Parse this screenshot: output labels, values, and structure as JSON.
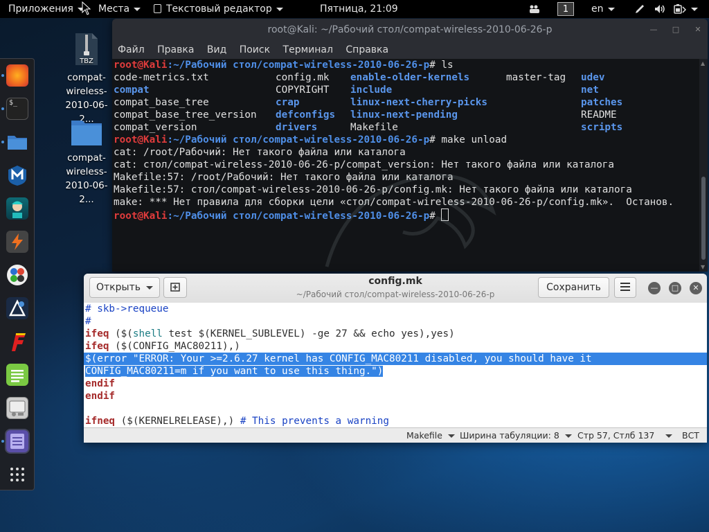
{
  "topbar": {
    "apps_label": "Приложения",
    "places_label": "Места",
    "active_app_label": "Текстовый редактор",
    "clock": "Пятница, 21:09",
    "workspace": "1",
    "keyboard_layout": "en"
  },
  "desktop_icons": [
    {
      "badge": "TBZ",
      "label": "compat-wireless-2010-06-2..."
    },
    {
      "label": "compat-wireless-2010-06-2..."
    }
  ],
  "dock": {
    "items": [
      "firefox-icon",
      "terminal-icon",
      "files-icon",
      "metasploit-icon",
      "armitage-icon",
      "burpsuite-icon",
      "maltego-icon",
      "beef-icon",
      "faraday-icon",
      "leafpad-icon",
      "cherrytree-icon",
      "text-editor-icon",
      "show-apps-icon"
    ]
  },
  "terminal": {
    "title": "root@Kali: ~/Рабочий стол/compat-wireless-2010-06-26-p",
    "menu": [
      "Файл",
      "Правка",
      "Вид",
      "Поиск",
      "Терминал",
      "Справка"
    ],
    "prompt_user": "root@Kali",
    "prompt_path": ":~/Рабочий стол/compat-wireless-2010-06-26-p",
    "prompt_suffix": "# ",
    "cmd1": "ls",
    "ls_rows": [
      [
        {
          "t": "code-metrics.txt",
          "d": false
        },
        {
          "t": "config.mk",
          "d": false
        },
        {
          "t": "enable-older-kernels",
          "d": true
        },
        {
          "t": "master-tag",
          "d": false
        },
        {
          "t": "udev",
          "d": true
        }
      ],
      [
        {
          "t": "compat",
          "d": true
        },
        {
          "t": "COPYRIGHT",
          "d": false
        },
        {
          "t": "include",
          "d": true
        },
        {
          "t": "",
          "d": false
        },
        {
          "t": "net",
          "d": true
        }
      ],
      [
        {
          "t": "compat_base_tree",
          "d": false
        },
        {
          "t": "crap",
          "d": true
        },
        {
          "t": "linux-next-cherry-picks",
          "d": true
        },
        {
          "t": "",
          "d": false
        },
        {
          "t": "patches",
          "d": true
        }
      ],
      [
        {
          "t": "compat_base_tree_version",
          "d": false
        },
        {
          "t": "defconfigs",
          "d": true
        },
        {
          "t": "linux-next-pending",
          "d": true
        },
        {
          "t": "",
          "d": false
        },
        {
          "t": "README",
          "d": false
        }
      ],
      [
        {
          "t": "compat_version",
          "d": false
        },
        {
          "t": "drivers",
          "d": true
        },
        {
          "t": "Makefile",
          "d": false
        },
        {
          "t": "",
          "d": false
        },
        {
          "t": "scripts",
          "d": true
        }
      ]
    ],
    "cmd2": "make unload",
    "output": [
      "cat: /root/Рабочий: Нет такого файла или каталога",
      "cat: стол/compat-wireless-2010-06-26-p/compat_version: Нет такого файла или каталога",
      "Makefile:57: /root/Рабочий: Нет такого файла или каталога",
      "Makefile:57: стол/compat-wireless-2010-06-26-p/config.mk: Нет такого файла или каталога",
      "make: *** Нет правила для сборки цели «стол/compat-wireless-2010-06-26-p/config.mk».  Останов."
    ]
  },
  "editor": {
    "open_label": "Открыть",
    "save_label": "Сохранить",
    "title": "config.mk",
    "subtitle": "~/Рабочий стол/compat-wireless-2010-06-26-p",
    "lines": {
      "l1": "# skb->requeue",
      "l2": "#",
      "l3_kw": "ifeq",
      "l3_a": " ($(",
      "l3_fn": "shell",
      "l3_b": " test $(KERNEL_SUBLEVEL) -ge 27 && echo yes),yes)",
      "l4_kw": "ifeq",
      "l4_b": " ($(CONFIG_MAC80211),)",
      "l5": "$(error \"ERROR: Your >=2.6.27 kernel has CONFIG_MAC80211 disabled, you should have it",
      "l6": "CONFIG_MAC80211=m if you want to use this thing.\")",
      "l7": "endif",
      "l8": "endif",
      "l9": "",
      "l10_kw": "ifneq",
      "l10_b": " ($(KERNELRELEASE),) ",
      "l10_c": "# This prevents a warning"
    },
    "status": {
      "language": "Makefile",
      "tab_width": "Ширина табуляции: 8",
      "position": "Стр 57, Стлб 137",
      "mode": "ВСТ"
    }
  },
  "colors": {
    "terminal_bg": "#121417",
    "prompt_user": "#e03c3c",
    "prompt_path": "#4f8fe8",
    "selection": "#3584e4"
  }
}
